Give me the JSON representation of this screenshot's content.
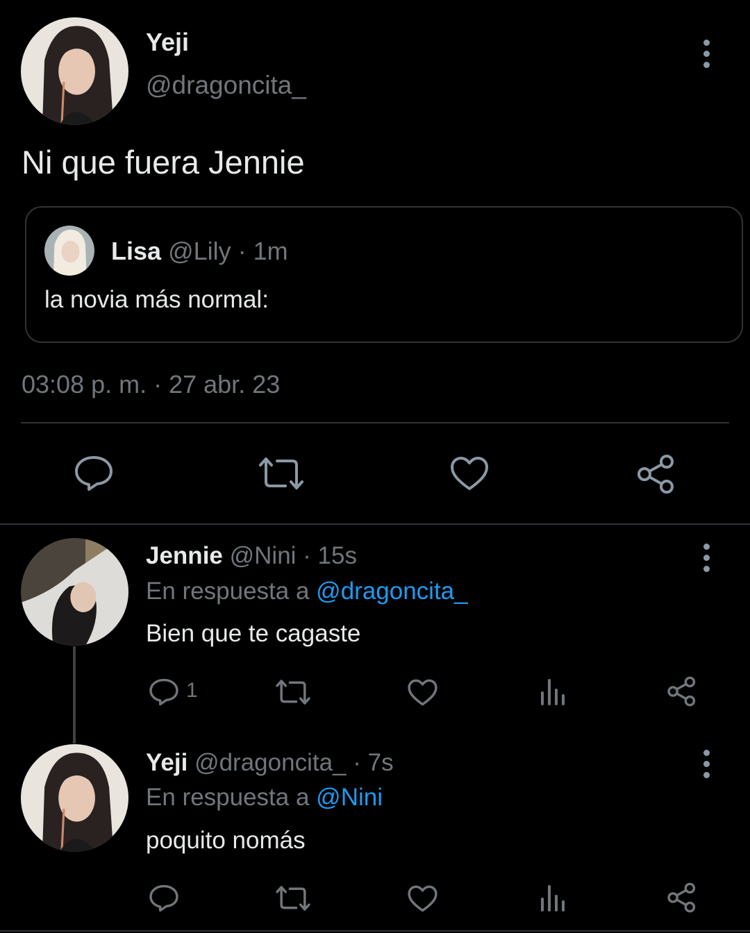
{
  "main_tweet": {
    "author_name": "Yeji",
    "author_handle": "@dragoncita_",
    "text": "Ni que fuera Jennie",
    "timestamp": "03:08 p. m. · 27 abr. 23",
    "quoted": {
      "name": "Lisa",
      "meta": "@Lily · 1m",
      "text": "la novia más normal:"
    },
    "actions": [
      "reply-icon",
      "retweet-icon",
      "like-icon",
      "share-icon"
    ]
  },
  "replies": [
    {
      "name": "Jennie",
      "meta": "@Nini · 15s",
      "reply_prefix": "En respuesta a",
      "reply_to": "@dragoncita_",
      "text": "Bien que te cagaste",
      "reply_count": "1"
    },
    {
      "name": "Yeji",
      "meta": "@dragoncita_ · 7s",
      "reply_prefix": "En respuesta a",
      "reply_to": "@Nini",
      "text": "poquito nomás",
      "reply_count": ""
    }
  ],
  "colors": {
    "background": "#000000",
    "text": "#e7e9ea",
    "muted": "#71767b",
    "link": "#1d9bf0",
    "border": "#2f3336"
  }
}
